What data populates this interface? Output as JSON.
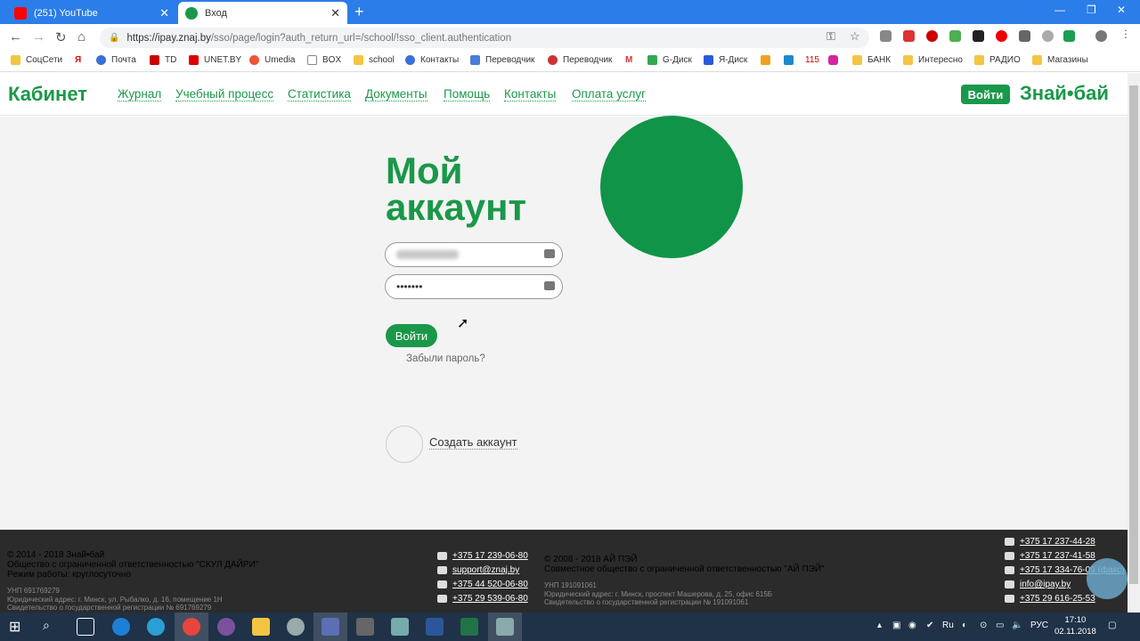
{
  "browser": {
    "tabs": [
      {
        "label": "(251) YouTube",
        "active": false
      },
      {
        "label": "Вход",
        "active": true
      }
    ],
    "url_host": "https://ipay.znaj.by",
    "url_path": "/sso/page/login?auth_return_url=/school/!sso_client.authentication",
    "bookmarks": [
      "СоцСети",
      "Я",
      "Почта",
      "TD",
      "UNET.BY",
      "Umedia",
      "BOX",
      "school",
      "Контакты",
      "Переводчик",
      "Переводчик",
      "M",
      "G-Диск",
      "Я-Диск",
      "115",
      "БАНК",
      "Интересно",
      "РАДИО",
      "Магазины"
    ]
  },
  "header": {
    "logo": "Кабинет",
    "nav": [
      "Журнал",
      "Учебный процесс",
      "Статистика",
      "Документы",
      "Помощь",
      "Контакты",
      "Оплата услуг"
    ],
    "login_label": "Войти",
    "brand": "Знай•бай"
  },
  "main": {
    "title_line1": "Мой",
    "title_line2": "аккаунт",
    "password_mask": "•••••••",
    "login_label": "Войти",
    "forgot_label": "Забыли пароль?",
    "create_label": "Создать аккаунт"
  },
  "footer": {
    "left": {
      "line1": "© 2014 - 2018 Знай•бай",
      "line2": "Общество с ограниченной ответственностью \"СКУЛ ДАЙРИ\"",
      "line3": "Режим работы: круглосуточно",
      "unp": "УНП 691769279",
      "address": "Юридический адрес: г. Минск, ул. Рыбалко, д. 16, помещение 1Н",
      "reg": "Свидетельство о государственной регистрации № 691769279"
    },
    "left_contacts": [
      "+375 17 239-06-80",
      "support@znaj.by",
      "+375 44 520-06-80",
      "+375 29 539-06-80"
    ],
    "right": {
      "line1": "© 2008 - 2018 АЙ ПЭЙ",
      "line2": "Совместное общество с ограниченной ответственностью \"АЙ ПЭЙ\"",
      "unp": "УНП 191091061",
      "address": "Юридический адрес: г. Минск, проспект Машерова, д. 25, офис 615Б",
      "reg": "Свидетельство о государственной регистрации № 191091061"
    },
    "right_contacts": [
      "+375 17 237-44-28",
      "+375 17 237-41-58",
      "+375 17 334-76-09 (факс)",
      "info@ipay.by",
      "+375 29 616-25-53"
    ]
  },
  "taskbar": {
    "lang": "РУС",
    "time": "17:10",
    "date": "02.11.2018"
  },
  "colors": {
    "brand_green": "#1a9849",
    "circle_green": "#109447"
  }
}
